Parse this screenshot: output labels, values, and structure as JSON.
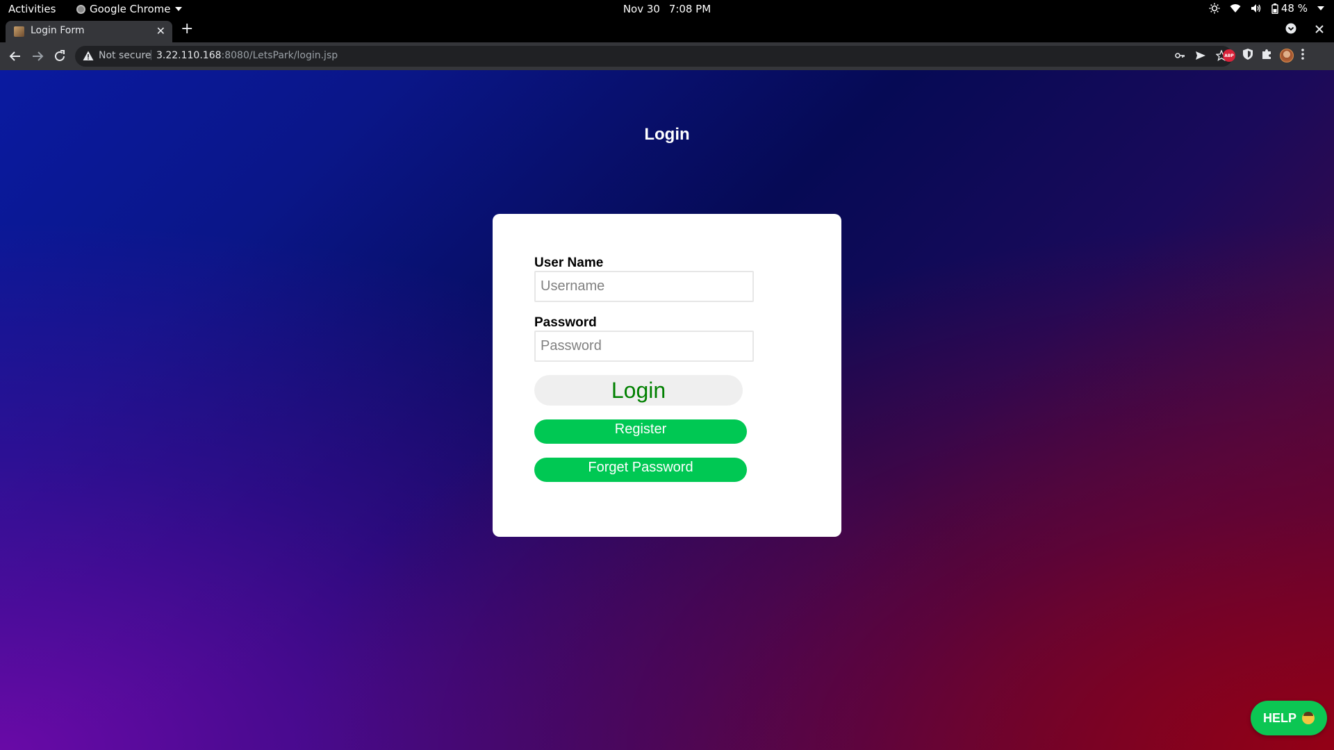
{
  "system_bar": {
    "activities": "Activities",
    "app_name": "Google Chrome",
    "date": "Nov 30",
    "time": "7:08 PM",
    "battery": "48 %"
  },
  "browser": {
    "tab_title": "Login Form",
    "new_tab": "+",
    "not_secure": "Not secure",
    "url_host": "3.22.110.168",
    "url_rest": ":8080/LetsPark/login.jsp",
    "extension_abp": "ABP"
  },
  "page": {
    "title": "Login",
    "username_label": "User Name",
    "username_placeholder": "Username",
    "username_value": "",
    "password_label": "Password",
    "password_placeholder": "Password",
    "password_value": "",
    "login_button": "Login",
    "register_button": "Register",
    "forget_password_button": "Forget Password",
    "help_button": "HELP"
  },
  "colors": {
    "primary_green": "#00c853",
    "login_text": "#008000",
    "help_green": "#0cc653"
  }
}
